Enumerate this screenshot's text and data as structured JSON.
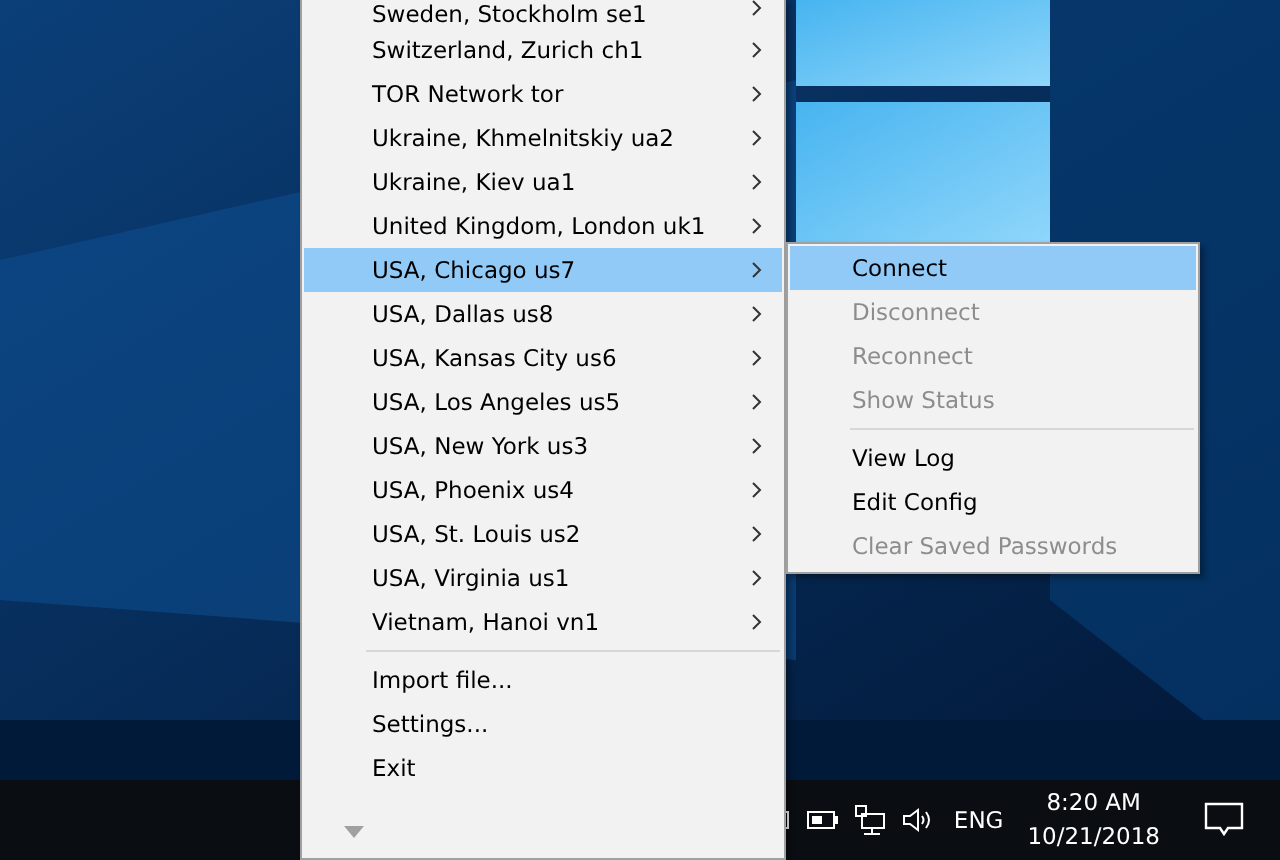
{
  "menu": {
    "items": [
      {
        "kind": "server",
        "label": "Sweden, Stockholm se1",
        "selected": false
      },
      {
        "kind": "server",
        "label": "Switzerland, Zurich ch1",
        "selected": false
      },
      {
        "kind": "server",
        "label": "TOR Network tor",
        "selected": false
      },
      {
        "kind": "server",
        "label": "Ukraine, Khmelnitskiy ua2",
        "selected": false
      },
      {
        "kind": "server",
        "label": "Ukraine, Kiev ua1",
        "selected": false
      },
      {
        "kind": "server",
        "label": "United Kingdom, London uk1",
        "selected": false
      },
      {
        "kind": "server",
        "label": "USA, Chicago us7",
        "selected": true
      },
      {
        "kind": "server",
        "label": "USA, Dallas us8",
        "selected": false
      },
      {
        "kind": "server",
        "label": "USA, Kansas City us6",
        "selected": false
      },
      {
        "kind": "server",
        "label": "USA, Los Angeles us5",
        "selected": false
      },
      {
        "kind": "server",
        "label": "USA, New York us3",
        "selected": false
      },
      {
        "kind": "server",
        "label": "USA, Phoenix us4",
        "selected": false
      },
      {
        "kind": "server",
        "label": "USA, St. Louis us2",
        "selected": false
      },
      {
        "kind": "server",
        "label": "USA, Virginia us1",
        "selected": false
      },
      {
        "kind": "server",
        "label": "Vietnam, Hanoi vn1",
        "selected": false
      },
      {
        "kind": "separator"
      },
      {
        "kind": "command",
        "label": "Import file...",
        "selected": false
      },
      {
        "kind": "command",
        "label": "Settings...",
        "selected": false
      },
      {
        "kind": "command",
        "label": "Exit",
        "selected": false
      }
    ]
  },
  "submenu": {
    "items": [
      {
        "kind": "command",
        "label": "Connect",
        "selected": true,
        "disabled": false
      },
      {
        "kind": "command",
        "label": "Disconnect",
        "selected": false,
        "disabled": true
      },
      {
        "kind": "command",
        "label": "Reconnect",
        "selected": false,
        "disabled": true
      },
      {
        "kind": "command",
        "label": "Show Status",
        "selected": false,
        "disabled": true
      },
      {
        "kind": "separator"
      },
      {
        "kind": "command",
        "label": "View Log",
        "selected": false,
        "disabled": false
      },
      {
        "kind": "command",
        "label": "Edit Config",
        "selected": false,
        "disabled": false
      },
      {
        "kind": "command",
        "label": "Clear Saved Passwords",
        "selected": false,
        "disabled": true
      }
    ]
  },
  "taskbar": {
    "language": "ENG",
    "time": "8:20 AM",
    "date": "10/21/2018"
  }
}
